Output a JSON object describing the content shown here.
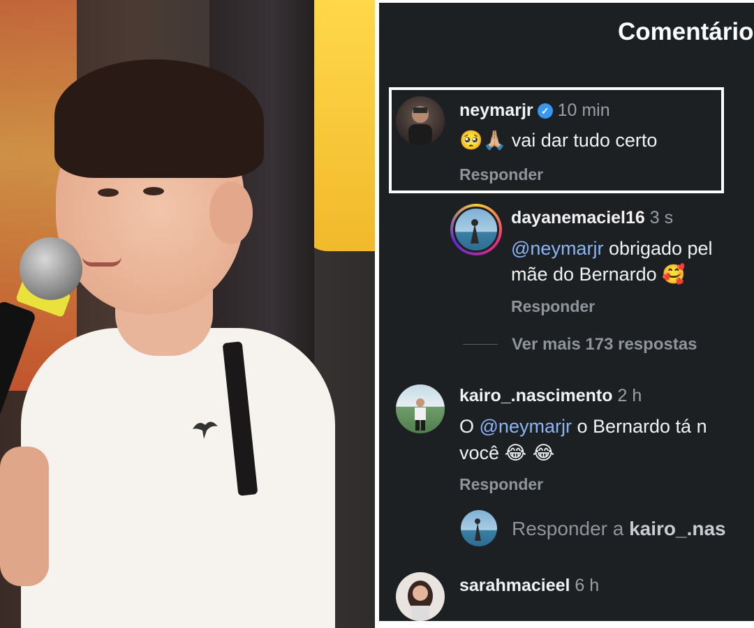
{
  "panel": {
    "title": "Comentário"
  },
  "comments": [
    {
      "username": "neymarjr",
      "time": "10 min",
      "text_emoji": "🥺🙏🏼",
      "text": "vai dar tudo certo",
      "reply_label": "Responder"
    },
    {
      "username": "dayanemaciel16",
      "time": "3 s",
      "mention": "@neymarjr",
      "text_line1_rest": " obrigado pel",
      "text_line2": "mãe do Bernardo",
      "text_line2_emoji": "🥰",
      "reply_label": "Responder"
    },
    {
      "username": "kairo_.nascimento",
      "time": "2 h",
      "line1_prefix": "O ",
      "mention": "@neymarjr",
      "line1_rest": " o Bernardo tá n",
      "line2": "você",
      "line2_emoji": "😂 😂",
      "reply_label": "Responder"
    },
    {
      "username": "sarahmacieel",
      "time": "6 h"
    }
  ],
  "more_replies": "Ver mais 173 respostas",
  "reply_input": {
    "prefix": "Responder a ",
    "target": "kairo_.nas"
  },
  "icons": {
    "verified": "verified-badge-icon"
  },
  "colors": {
    "panel_bg": "#1d2023",
    "mention": "#8ab6f4",
    "verified": "#3897f0"
  }
}
